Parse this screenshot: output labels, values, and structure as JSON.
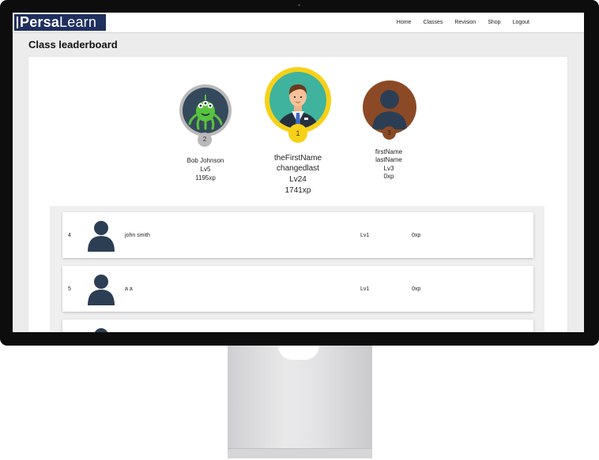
{
  "navbar": {
    "logo_bold": "Persa",
    "logo_light": "Learn",
    "links": [
      "Home",
      "Classes",
      "Revision",
      "Shop",
      "Logout"
    ]
  },
  "page": {
    "title": "Class leaderboard"
  },
  "podium": [
    {
      "rank": "1",
      "name1": "theFirstName",
      "name2": "changedlast",
      "level": "Lv24",
      "xp": "1741xp",
      "avatar": "businessman-icon"
    },
    {
      "rank": "2",
      "name": "Bob Johnson",
      "level": "Lv5",
      "xp": "1195xp",
      "avatar": "green-alien-icon"
    },
    {
      "rank": "3",
      "name1": "firstName",
      "name2": "lastName",
      "level": "Lv3",
      "xp": "0xp",
      "avatar": "default-user-icon"
    }
  ],
  "leaderboard": [
    {
      "rank": "4",
      "name": "john smith",
      "level": "Lv1",
      "xp": "0xp",
      "avatar": "default-user-icon"
    },
    {
      "rank": "5",
      "name": "a a",
      "level": "Lv1",
      "xp": "0xp",
      "avatar": "default-user-icon"
    }
  ],
  "colors": {
    "gold": "#f7d117",
    "silver": "#b9b9b9",
    "bronze": "#8b4a25",
    "navy": "#1f2f5e",
    "avatar_dark": "#2c3e54"
  }
}
